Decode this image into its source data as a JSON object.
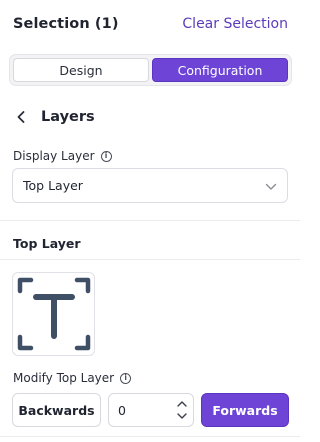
{
  "header": {
    "title": "Selection (1)",
    "clear_label": "Clear Selection"
  },
  "tabs": [
    {
      "label": "Design",
      "active": false
    },
    {
      "label": "Configuration",
      "active": true
    }
  ],
  "layers": {
    "title": "Layers"
  },
  "display_layer": {
    "label": "Display Layer",
    "value": "Top Layer"
  },
  "top_layer": {
    "title": "Top Layer",
    "thumbnail_icon": "text-t-icon"
  },
  "modify": {
    "label": "Modify Top Layer",
    "backwards_label": "Backwards",
    "value": "0",
    "forwards_label": "Forwards"
  },
  "colors": {
    "accent": "#6d44d6",
    "link": "#5c3bb8"
  }
}
